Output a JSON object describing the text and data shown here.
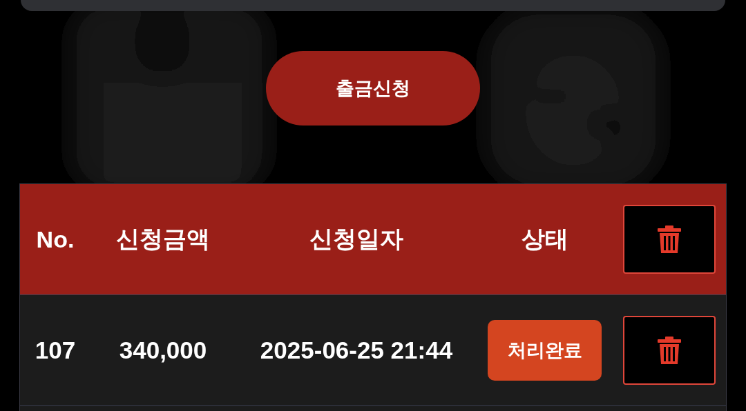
{
  "withdraw_button": {
    "label": "출금신청"
  },
  "table": {
    "columns": [
      "No.",
      "신청금액",
      "신청일자",
      "상태"
    ],
    "rows": [
      {
        "no": "107",
        "amount": "340,000",
        "date": "2025-06-25 21:44",
        "status": "처리완료"
      }
    ]
  }
}
